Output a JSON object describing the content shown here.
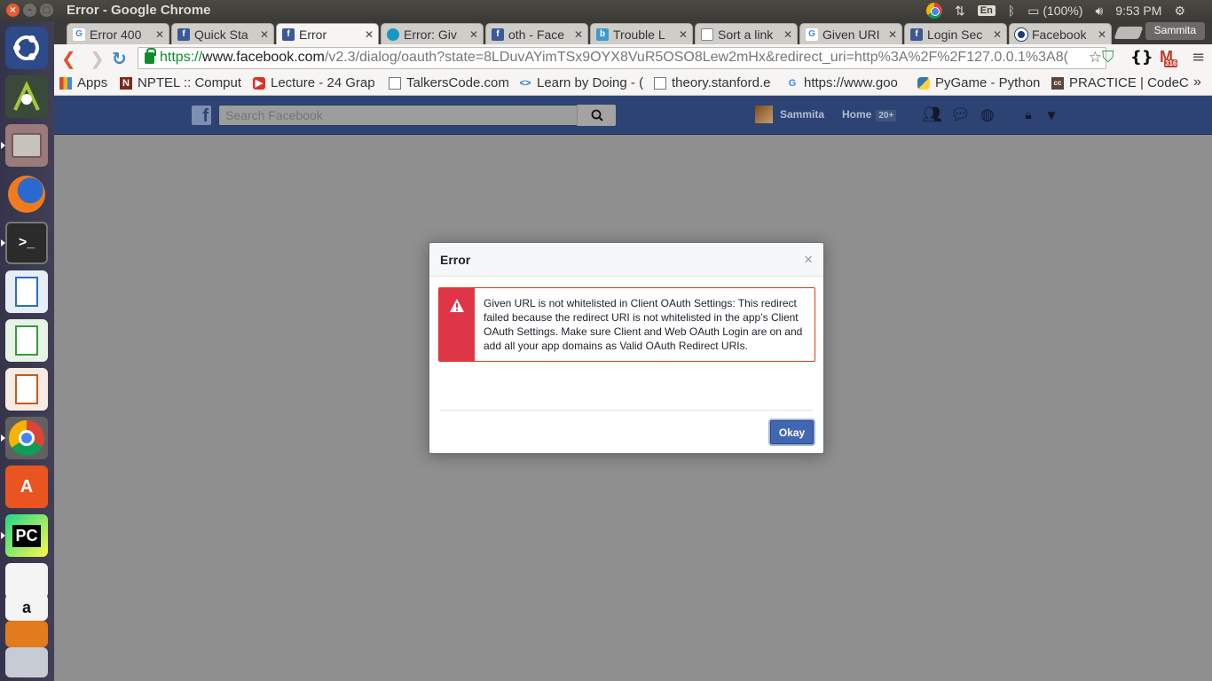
{
  "os_panel": {
    "window_title": "Error - Google Chrome",
    "keyboard_lang": "En",
    "battery": "(100%)",
    "clock": "9:53 PM"
  },
  "tabs": [
    {
      "title": "Error 400",
      "icon": "google-icon",
      "active": false
    },
    {
      "title": "Quick Sta",
      "icon": "facebook-icon",
      "active": false
    },
    {
      "title": "Error",
      "icon": "facebook-icon",
      "active": true
    },
    {
      "title": "Error: Giv",
      "icon": "salesforce-icon",
      "active": false
    },
    {
      "title": "oth - Face",
      "icon": "facebook-icon",
      "active": false
    },
    {
      "title": "Trouble L",
      "icon": "b-icon",
      "active": false
    },
    {
      "title": "Sort a link",
      "icon": "page-icon",
      "active": false
    },
    {
      "title": "Given URI",
      "icon": "google-icon",
      "active": false
    },
    {
      "title": "Login Sec",
      "icon": "facebook-icon",
      "active": false
    },
    {
      "title": "Facebook",
      "icon": "circle-icon",
      "active": false
    }
  ],
  "profile_name": "Sammita",
  "omnibox": {
    "scheme": "https://",
    "host": "www.facebook.com",
    "path": "/v2.3/dialog/oauth?state=8LDuvAYimTSx9OYX8VuR5OSO8Lew2mHx&redirect_uri=http%3A%2F%2F127.0.0.1%3A8("
  },
  "gmail_badge": "316",
  "bookmarks": [
    {
      "label": "Apps",
      "icon": "apps-grid-icon"
    },
    {
      "label": "NPTEL :: Comput",
      "icon": "nptel-icon"
    },
    {
      "label": "Lecture - 24 Grap",
      "icon": "youtube-icon"
    },
    {
      "label": "TalkersCode.com",
      "icon": "page-icon"
    },
    {
      "label": "Learn by Doing - (",
      "icon": "code-icon"
    },
    {
      "label": "theory.stanford.e",
      "icon": "page-icon"
    },
    {
      "label": "https://www.goo",
      "icon": "google-icon"
    },
    {
      "label": "PyGame - Python",
      "icon": "python-icon"
    },
    {
      "label": "PRACTICE | CodeC",
      "icon": "codechef-icon"
    }
  ],
  "facebook": {
    "search_placeholder": "Search Facebook",
    "user_name": "Sammita",
    "home_label": "Home",
    "home_count": "20+"
  },
  "dialog": {
    "title": "Error",
    "close_glyph": "×",
    "message": "Given URL is not whitelisted in Client OAuth Settings: This redirect failed because the redirect URI is not whitelisted in the app’s Client OAuth Settings. Make sure Client and Web OAuth Login are on and add all your app domains as Valid OAuth Redirect URIs.",
    "button_label": "Okay"
  },
  "colors": {
    "fb_blue": "#2d4373",
    "error_red": "#df3548",
    "button_blue": "#4267b2"
  }
}
